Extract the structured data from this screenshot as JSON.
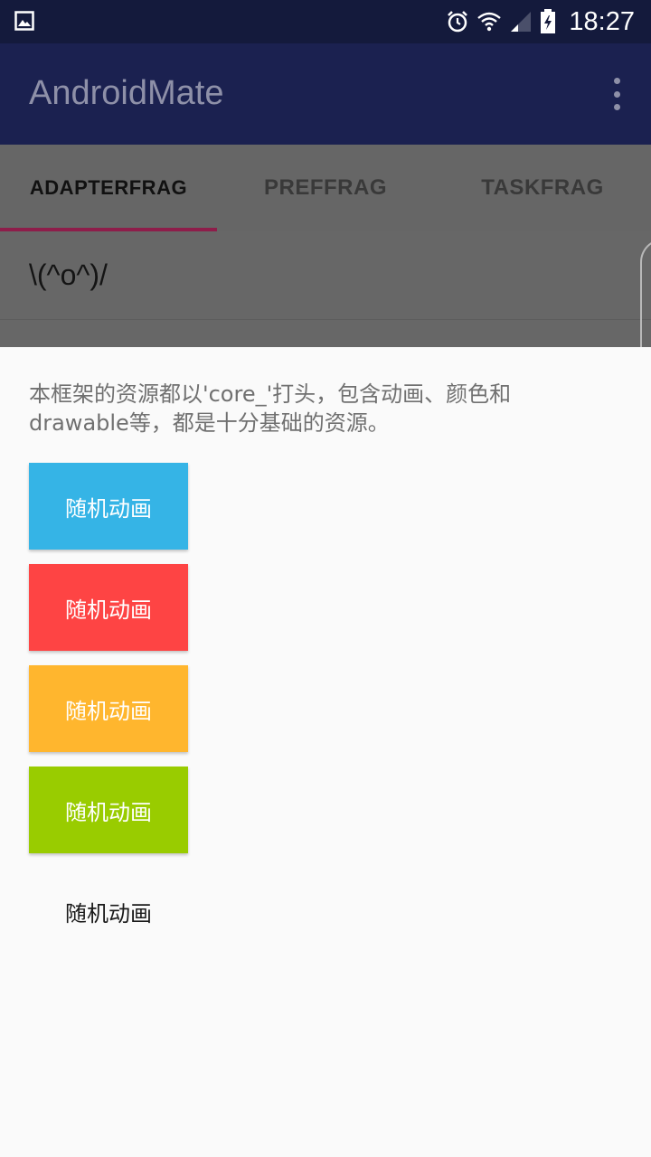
{
  "status_bar": {
    "time": "18:27",
    "icons": [
      "gallery-icon",
      "alarm-icon",
      "wifi-icon",
      "signal-icon",
      "battery-icon"
    ]
  },
  "app_bar": {
    "title": "AndroidMate",
    "menu_icon": "more-vert-icon"
  },
  "tabs": [
    {
      "label": "ADAPTERFRAG",
      "active": true
    },
    {
      "label": "PREFFRAG",
      "active": false
    },
    {
      "label": "TASKFRAG",
      "active": false
    }
  ],
  "list": {
    "rows": [
      "\\(^o^)/"
    ]
  },
  "sheet": {
    "description": "本框架的资源都以'core_'打头，包含动画、颜色和drawable等，都是十分基础的资源。",
    "buttons": [
      {
        "label": "随机动画",
        "color": "#35b4e6"
      },
      {
        "label": "随机动画",
        "color": "#fe4444"
      },
      {
        "label": "随机动画",
        "color": "#ffb62e"
      },
      {
        "label": "随机动画",
        "color": "#99cc00"
      },
      {
        "label": "随机动画",
        "color": "#fafafa"
      }
    ]
  },
  "colors": {
    "status_bar": "#141a3c",
    "app_bar": "#1b2150",
    "tab_indicator": "#8e1d4a",
    "scrim": "#666666"
  }
}
